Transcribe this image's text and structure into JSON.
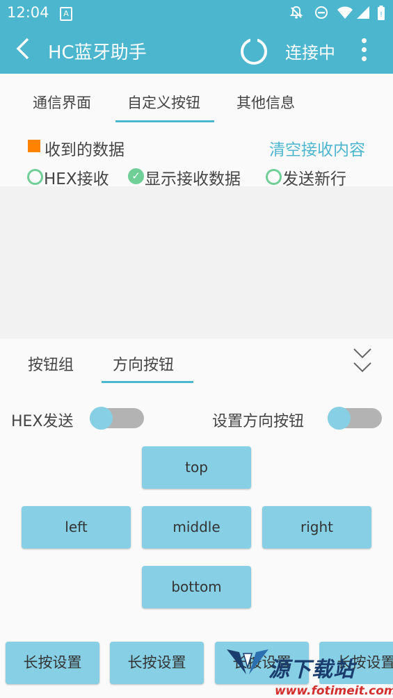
{
  "status_bar": {
    "time": "12:04",
    "app_icon_letter": "A"
  },
  "app_bar": {
    "back_icon": "back-arrow-icon",
    "title": "HC蓝牙助手",
    "status": "连接中",
    "menu_icon": "overflow-menu-icon"
  },
  "top_tabs": [
    {
      "label": "通信界面"
    },
    {
      "label": "自定义按钮"
    },
    {
      "label": "其他信息"
    }
  ],
  "receive": {
    "label": "收到的数据",
    "clear_label": "清空接收内容",
    "options": [
      {
        "label": "HEX接收"
      },
      {
        "label": "显示接收数据"
      },
      {
        "label": "发送新行"
      }
    ]
  },
  "lower_tabs": [
    {
      "label": "按钮组"
    },
    {
      "label": "方向按钮"
    }
  ],
  "switches": [
    {
      "label": "HEX发送"
    },
    {
      "label": "设置方向按钮"
    }
  ],
  "direction_buttons": {
    "top": "top",
    "left": "left",
    "middle": "middle",
    "right": "right",
    "bottom": "bottom"
  },
  "long_press_buttons": [
    {
      "label": "长按设置"
    },
    {
      "label": "长按设置"
    },
    {
      "label": "长按设置"
    },
    {
      "label": "长按设置"
    }
  ],
  "watermark": {
    "text": "源下载站",
    "url": "www.fotimeit.com"
  },
  "colors": {
    "primary": "#4db6cf",
    "button": "#86cfe4",
    "accent_square": "#ff8300",
    "radio": "#6fcf97",
    "watermark_red": "#d32f2f"
  }
}
